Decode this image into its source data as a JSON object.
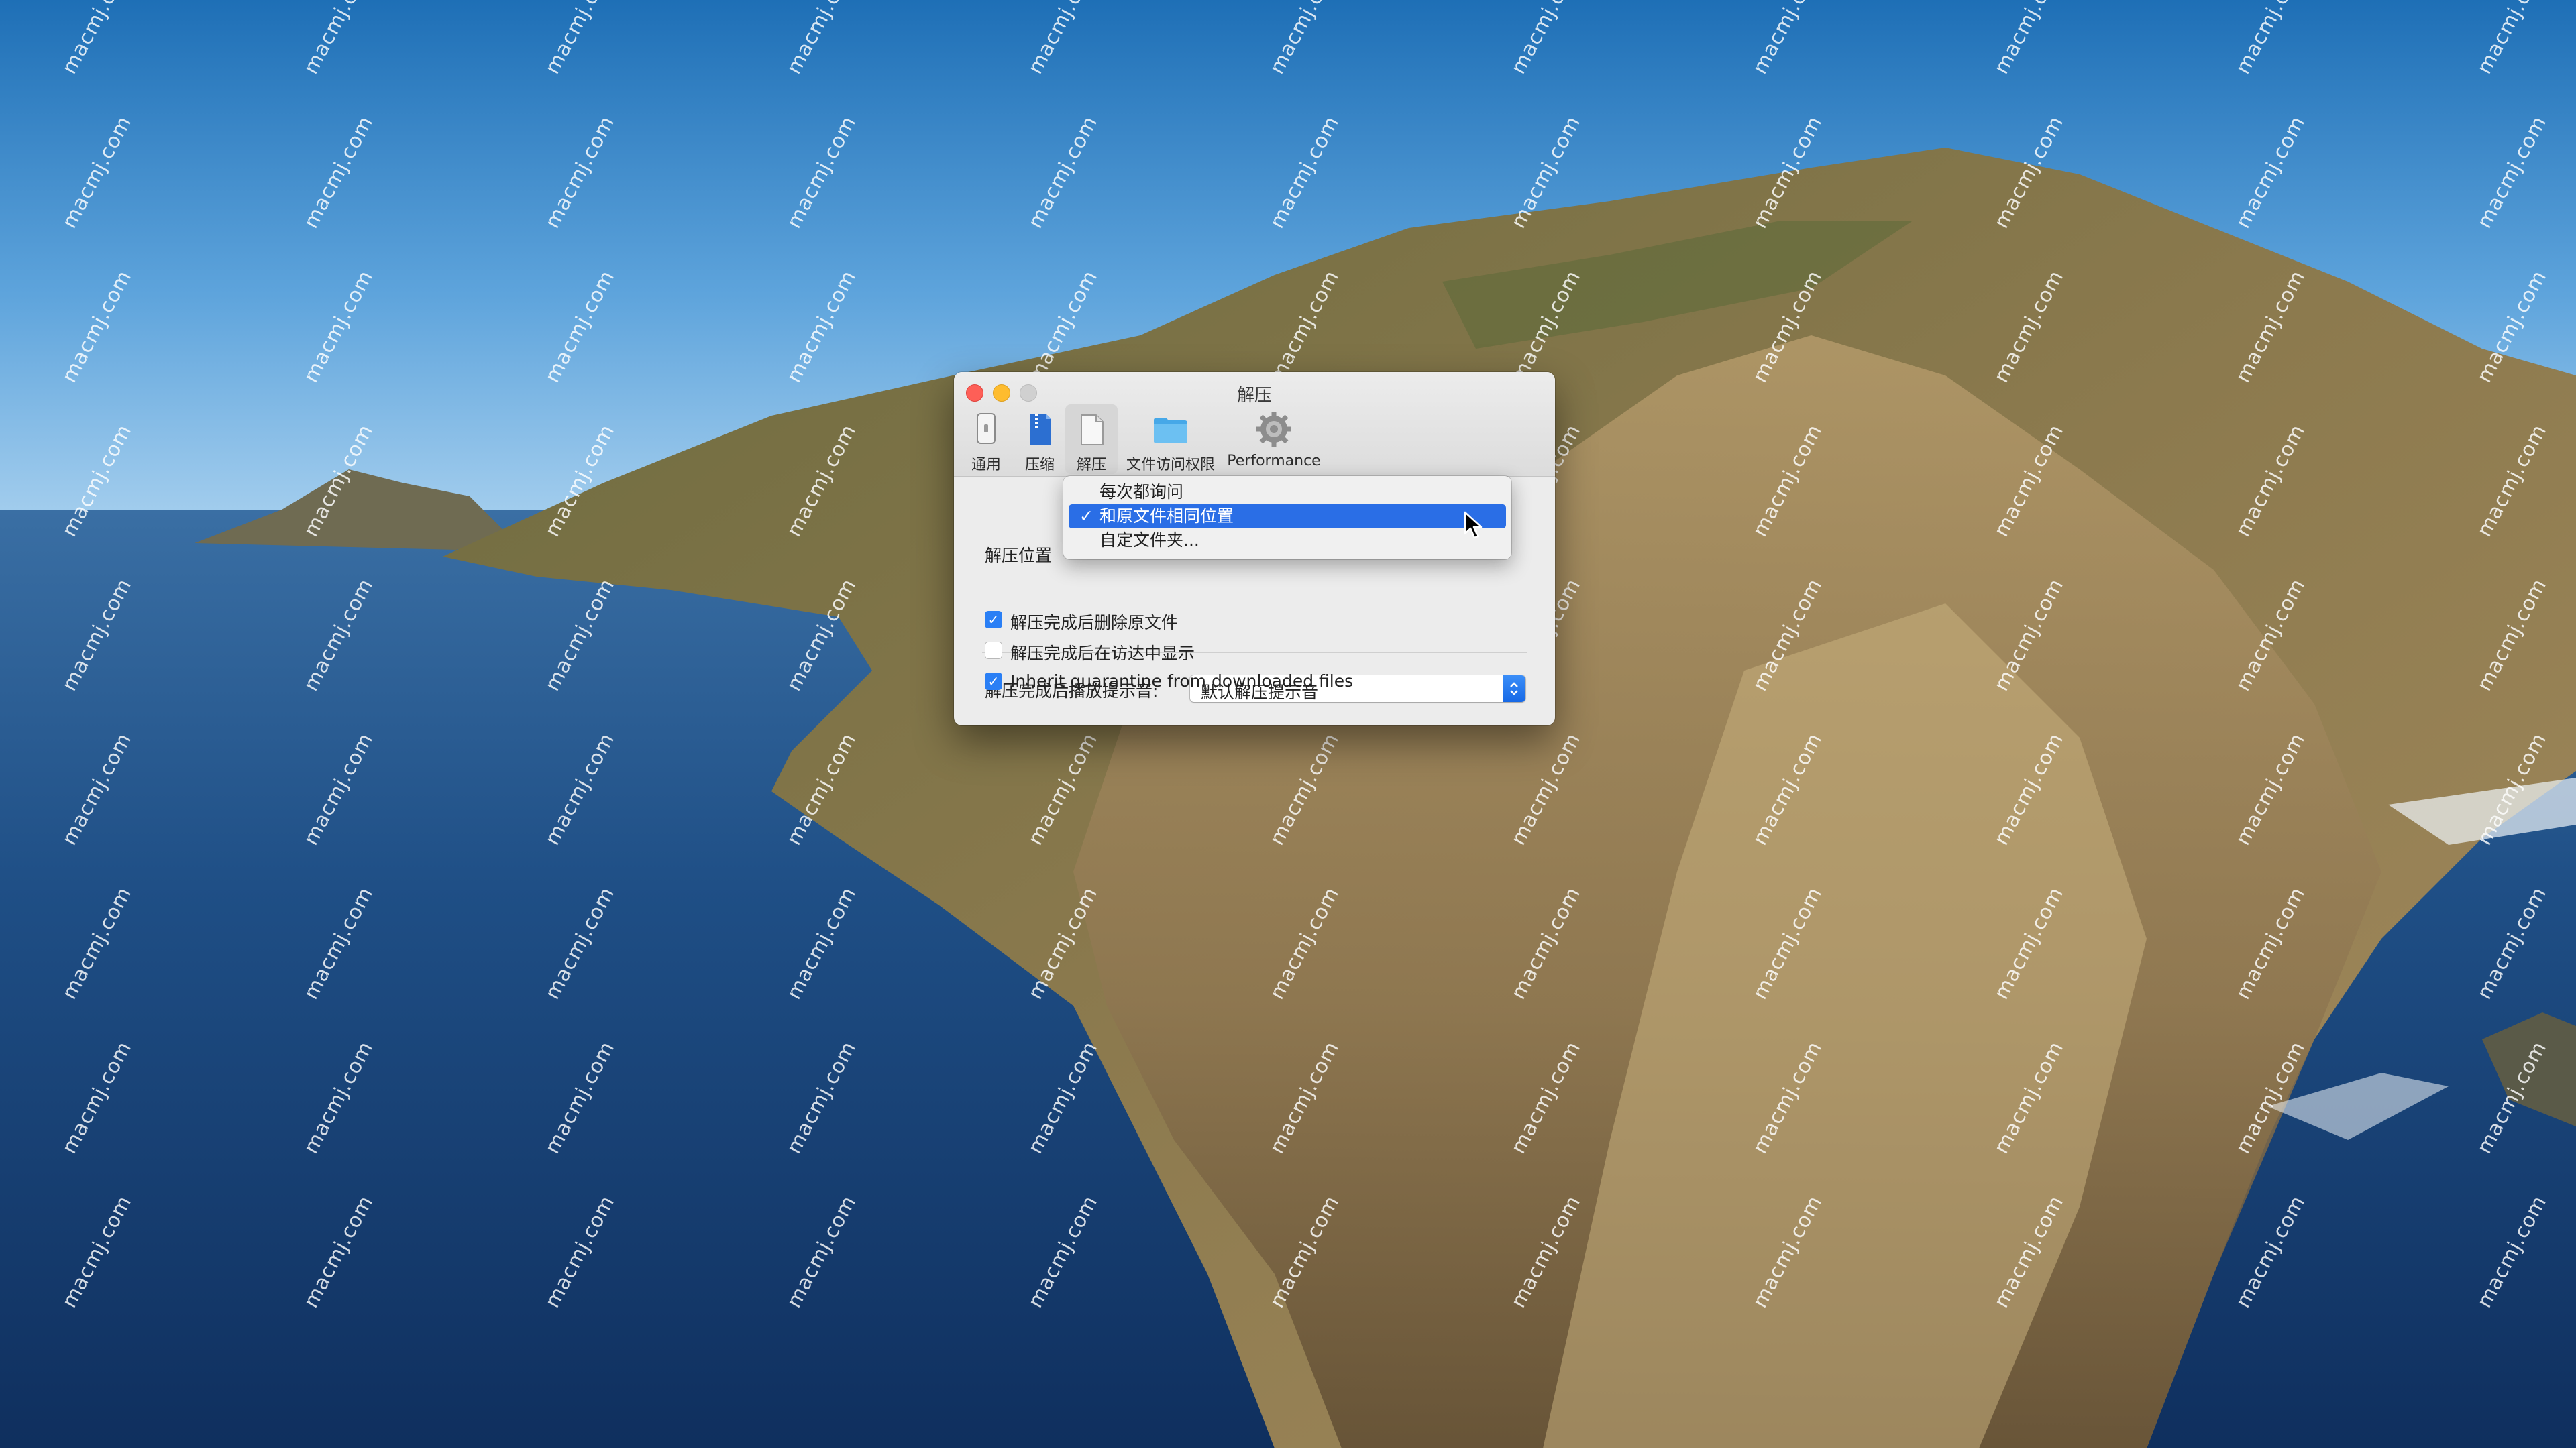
{
  "window": {
    "title": "解压",
    "toolbar": [
      {
        "label": "通用",
        "icon": "phone-icon"
      },
      {
        "label": "压缩",
        "icon": "archive-icon"
      },
      {
        "label": "解压",
        "icon": "document-icon",
        "selected": true
      },
      {
        "label": "文件访问权限",
        "icon": "folder-icon"
      },
      {
        "label": "Performance",
        "icon": "gear-icon"
      }
    ]
  },
  "extract": {
    "location_label": "解压位置",
    "location_options": [
      "每次都询问",
      "和原文件相同位置",
      "自定文件夹..."
    ],
    "location_selected": "和原文件相同位置",
    "sound_label": "解压完成后播放提示音:",
    "sound_value": "默认解压提示音",
    "checkboxes": [
      {
        "label": "解压完成后删除原文件",
        "checked": true
      },
      {
        "label": "解压完成后在访达中显示",
        "checked": false
      },
      {
        "label": "Inherit quarantine from downloaded files",
        "checked": true
      }
    ]
  },
  "desktop": {
    "watermark_text": "macmj.com"
  },
  "colors": {
    "accent": "#2a6ee6",
    "checkbox_checked": "#2a7ff5",
    "close": "#fe5f57",
    "minimize": "#febc2e",
    "zoom_disabled": "#d0d0d0",
    "window_bg": "#ececec"
  }
}
